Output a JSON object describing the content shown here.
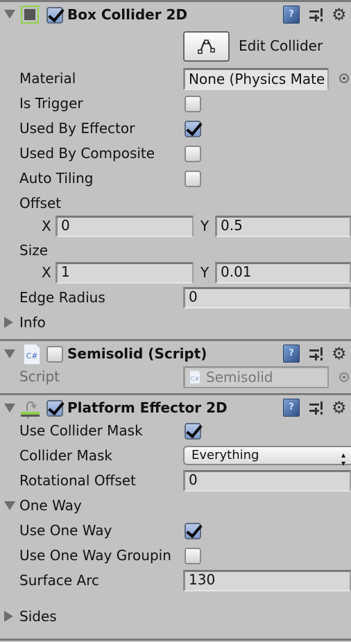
{
  "components": {
    "box_collider": {
      "title": "Box Collider 2D",
      "enabled": true,
      "icon": "box-collider-icon",
      "edit_collider_label": "Edit Collider",
      "edit_collider_icon": "edit-polygon-icon",
      "material": {
        "label": "Material",
        "value": "None (Physics Mate"
      },
      "is_trigger": {
        "label": "Is Trigger",
        "checked": false
      },
      "used_by_effector": {
        "label": "Used By Effector",
        "checked": true
      },
      "used_by_composite": {
        "label": "Used By Composite",
        "checked": false
      },
      "auto_tiling": {
        "label": "Auto Tiling",
        "checked": false
      },
      "offset": {
        "label": "Offset",
        "x_label": "X",
        "x": "0",
        "y_label": "Y",
        "y": "0.5"
      },
      "size": {
        "label": "Size",
        "x_label": "X",
        "x": "1",
        "y_label": "Y",
        "y": "0.01"
      },
      "edge_radius": {
        "label": "Edge Radius",
        "value": "0"
      },
      "info": {
        "label": "Info",
        "expanded": false
      }
    },
    "semisolid": {
      "title": "Semisolid (Script)",
      "enabled": false,
      "icon": "csharp-script-icon",
      "icon_text": "C#",
      "script": {
        "label": "Script",
        "value": "Semisolid",
        "icon_text": "C#"
      }
    },
    "platform_effector": {
      "title": "Platform Effector 2D",
      "enabled": true,
      "icon": "platform-effector-icon",
      "use_collider_mask": {
        "label": "Use Collider Mask",
        "checked": true
      },
      "collider_mask": {
        "label": "Collider Mask",
        "value": "Everything"
      },
      "rotational_offset": {
        "label": "Rotational Offset",
        "value": "0"
      },
      "one_way": {
        "label": "One Way",
        "expanded": true,
        "use_one_way": {
          "label": "Use One Way",
          "checked": true
        },
        "use_one_way_grouping": {
          "label": "Use One Way Groupin",
          "checked": false
        },
        "surface_arc": {
          "label": "Surface Arc",
          "value": "130"
        }
      },
      "sides": {
        "label": "Sides",
        "expanded": false
      }
    }
  },
  "header_icons": {
    "help": "?",
    "gear": "⚙"
  },
  "colors": {
    "background": "#c2c2c2",
    "checkbox_checked": "#7e9dcf",
    "enabled_green": "#8ed04a"
  }
}
